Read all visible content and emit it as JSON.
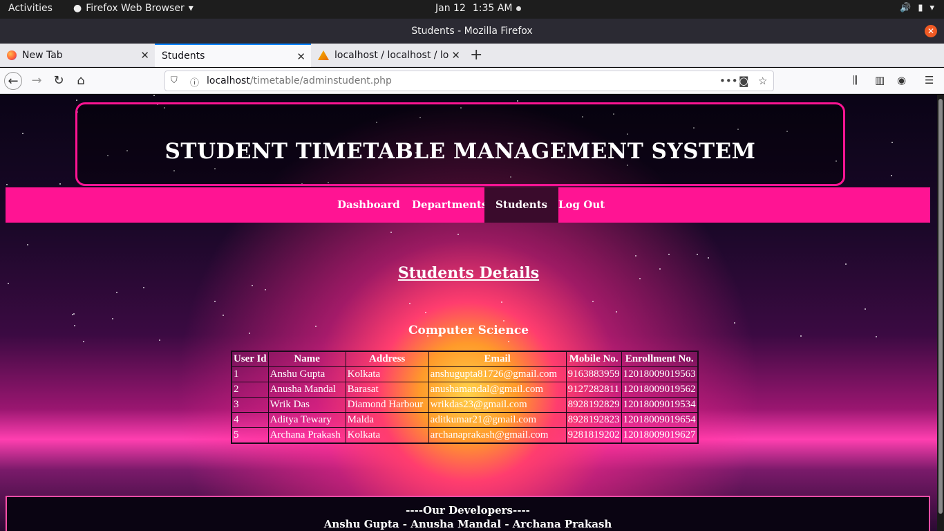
{
  "system_bar": {
    "activities": "Activities",
    "app_name": "Firefox Web Browser",
    "date": "Jan 12",
    "time": "1:35 AM"
  },
  "window": {
    "title": "Students - Mozilla Firefox"
  },
  "tabs": [
    {
      "label": "New Tab",
      "favicon": "firefox-icon"
    },
    {
      "label": "Students",
      "active": true
    },
    {
      "label": "localhost / localhost / logi",
      "favicon": "phpmyadmin-icon"
    }
  ],
  "urlbar": {
    "host": "localhost",
    "path": "/timetable/adminstudent.php"
  },
  "page": {
    "header_title": "STUDENT TIMETABLE MANAGEMENT SYSTEM",
    "menu": [
      "Dashboard",
      "Departments",
      "Students",
      "Log Out"
    ],
    "active_menu": "Students",
    "section_title": "Students Details",
    "department": "Computer Science",
    "table": {
      "columns": [
        "User Id",
        "Name",
        "Address",
        "Email",
        "Mobile No.",
        "Enrollment No."
      ],
      "rows": [
        [
          "1",
          "Anshu Gupta",
          "Kolkata",
          "anshugupta81726@gmail.com",
          "9163883959",
          "12018009019563"
        ],
        [
          "2",
          "Anusha Mandal",
          "Barasat",
          "anushamandal@gmail.com",
          "9127282811",
          "12018009019562"
        ],
        [
          "3",
          "Wrik Das",
          "Diamond Harbour",
          "wrikdas23@gmail.com",
          "8928192829",
          "12018009019534"
        ],
        [
          "4",
          "Aditya Tewary",
          "Malda",
          "aditkumar21@gmail.com",
          "8928192823",
          "12018009019654"
        ],
        [
          "5",
          "Archana Prakash",
          "Kolkata",
          "archanaprakash@gmail.com",
          "9281819202",
          "12018009019627"
        ]
      ]
    },
    "footer": {
      "heading": "----Our Developers----",
      "names": "Anshu Gupta - Anusha Mandal - Archana Prakash"
    }
  },
  "colors": {
    "accent": "#ff1493",
    "menu_active": "#3a0b2c"
  }
}
